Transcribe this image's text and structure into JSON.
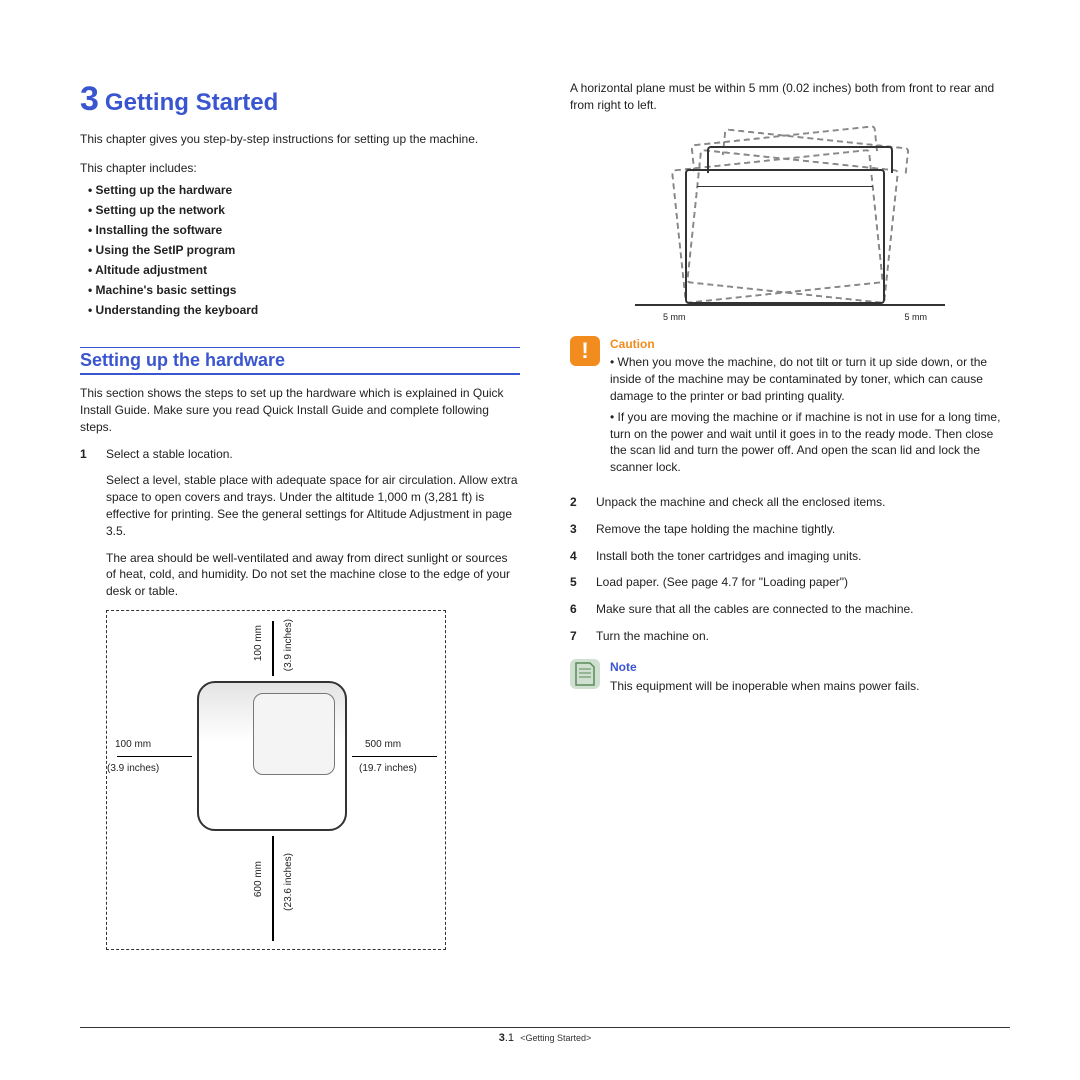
{
  "chapter": {
    "number": "3",
    "title": "Getting Started"
  },
  "intro": "This chapter gives you step-by-step instructions for setting up the machine.",
  "includes_label": "This chapter includes:",
  "toc": [
    "Setting up the hardware",
    "Setting up the network",
    "Installing the software",
    "Using the SetIP program",
    "Altitude adjustment",
    "Machine's basic settings",
    "Understanding the keyboard"
  ],
  "section1": {
    "title": "Setting up the hardware",
    "intro": "This section shows the steps to set up the hardware which is explained in Quick Install Guide. Make sure you read Quick Install Guide and complete following steps.",
    "step1_num": "1",
    "step1_text": "Select a stable location.",
    "step1_para1": "Select a level, stable place with adequate space for air circulation. Allow extra space to open covers and trays. Under the altitude 1,000 m (3,281 ft) is effective for printing. See the general settings for Altitude Adjustment in page 3.5.",
    "step1_para2": "The area should be well-ventilated and away from direct sunlight or sources of heat, cold, and humidity. Do not set the machine close to the edge of your desk or table."
  },
  "clearance": {
    "top_mm": "100 mm",
    "top_in": "(3.9 inches)",
    "left_mm": "100 mm",
    "left_in": "(3.9 inches)",
    "right_mm": "500 mm",
    "right_in": "(19.7 inches)",
    "bottom_mm": "600 mm",
    "bottom_in": "(23.6 inches)"
  },
  "tilt": {
    "intro": "A horizontal plane must be within 5 mm (0.02 inches) both from front to rear and from right to left.",
    "label_l": "5 mm",
    "label_r": "5 mm"
  },
  "caution": {
    "title": "Caution",
    "items": [
      "When you move the machine, do not tilt or turn it up side down, or the inside of the machine may be contaminated by toner, which can cause damage to the printer or bad printing quality.",
      "If you are moving the machine or if machine is not in use for a long time, turn on the power and wait until it goes in to the ready mode. Then close the scan lid and turn the power off. And open the scan lid and lock the scanner lock."
    ]
  },
  "steps_right": [
    {
      "n": "2",
      "t": "Unpack the machine and check all the enclosed items."
    },
    {
      "n": "3",
      "t": "Remove the tape holding the machine tightly."
    },
    {
      "n": "4",
      "t": "Install both the toner cartridges and imaging units."
    },
    {
      "n": "5",
      "t": "Load paper. (See  page 4.7 for \"Loading paper\")"
    },
    {
      "n": "6",
      "t": "Make sure that all the cables are connected to the machine."
    },
    {
      "n": "7",
      "t": "Turn the machine on."
    }
  ],
  "note": {
    "title": "Note",
    "text": "This equipment will be inoperable when mains power fails."
  },
  "footer": {
    "page_section": "3",
    "page_num": ".1",
    "crumb": "<Getting Started>"
  }
}
